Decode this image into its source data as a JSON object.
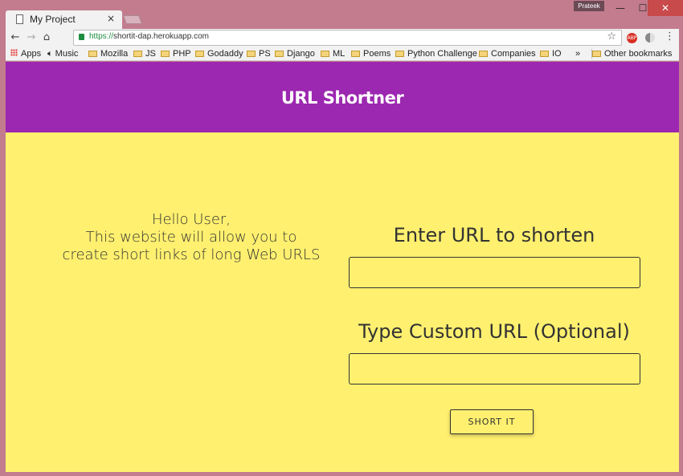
{
  "browser": {
    "tab_title": "My Project",
    "tab_close": "×",
    "user_label": "Prateek",
    "window_controls": {
      "minimize": "—",
      "maximize": "☐",
      "close": "✕"
    },
    "address": {
      "scheme": "https://",
      "host": "shortit-dap.herokuapp.com"
    },
    "bookmarks": [
      {
        "label": "Apps",
        "icon": "apps-icon"
      },
      {
        "label": "Music",
        "icon": "speaker-icon"
      },
      {
        "label": "Mozilla",
        "icon": "folder-icon"
      },
      {
        "label": "JS",
        "icon": "folder-icon"
      },
      {
        "label": "PHP",
        "icon": "folder-icon"
      },
      {
        "label": "Godaddy",
        "icon": "folder-icon"
      },
      {
        "label": "PS",
        "icon": "folder-icon"
      },
      {
        "label": "Django",
        "icon": "folder-icon"
      },
      {
        "label": "ML",
        "icon": "folder-icon"
      },
      {
        "label": "Poems",
        "icon": "folder-icon"
      },
      {
        "label": "Python Challenge",
        "icon": "folder-icon"
      },
      {
        "label": "Companies",
        "icon": "folder-icon"
      },
      {
        "label": "IO",
        "icon": "folder-icon"
      }
    ],
    "bookmarks_overflow": "»",
    "other_bookmarks": "Other bookmarks"
  },
  "page": {
    "title": "URL Shortner",
    "intro_line1": "Hello User,",
    "intro_line2": "This website will allow you to",
    "intro_line3": "create short links of long Web URLS",
    "url_label": "Enter URL to shorten",
    "url_value": "",
    "custom_label": "Type Custom URL (Optional)",
    "custom_value": "",
    "submit_label": "SHORT IT"
  },
  "colors": {
    "header_bg": "#9c27b0",
    "page_bg": "#fff06f",
    "frame": "#c27c8e"
  }
}
